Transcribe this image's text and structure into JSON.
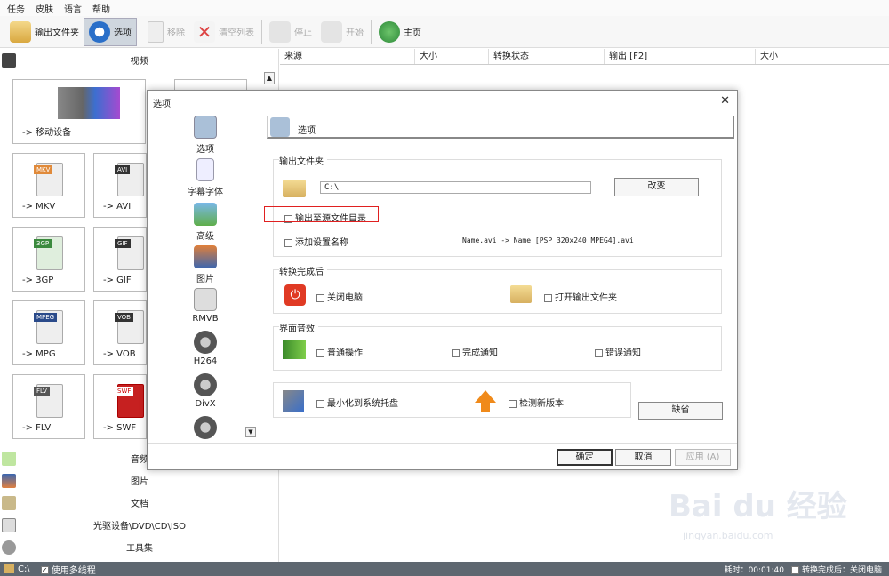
{
  "menu": [
    "任务",
    "皮肤",
    "语言",
    "帮助"
  ],
  "toolbar": {
    "output_folder": "输出文件夹",
    "options": "选项",
    "remove": "移除",
    "clear_list": "清空列表",
    "stop": "停止",
    "start": "开始",
    "home": "主页"
  },
  "left": {
    "video": "视频",
    "audio": "音频",
    "picture": "图片",
    "document": "文档",
    "rom": "光驱设备\\DVD\\CD\\ISO",
    "tools": "工具集",
    "tiles": {
      "mobile": "-> 移动设备",
      "mkv": "-> MKV",
      "avi": "-> AVI",
      "3gp": "-> 3GP",
      "gif": "-> GIF",
      "mpg": "-> MPG",
      "vob": "-> VOB",
      "flv": "-> FLV",
      "swf": "-> SWF"
    },
    "tags": {
      "avi": "AVI",
      "gif": "GIF",
      "mpeg": "MPEG",
      "vob": "VOB",
      "flv": "FLV",
      "swf": "SWF",
      "3gp": "3GP"
    }
  },
  "grid": {
    "cols": [
      "来源",
      "大小",
      "转换状态",
      "输出 [F2]",
      "大小"
    ]
  },
  "dialog": {
    "title": "选项",
    "header": "选项",
    "nav": [
      "选项",
      "字幕字体",
      "高级",
      "图片",
      "RMVB",
      "H264",
      "DivX"
    ],
    "output_folder": {
      "title": "输出文件夹",
      "path": "C:\\",
      "change": "改变",
      "to_source": "输出至源文件目录",
      "add_name": "添加设置名称",
      "example": "Name.avi  -> Name [PSP 320x240 MPEG4].avi"
    },
    "after": {
      "title": "转换完成后",
      "shutdown": "关闭电脑",
      "open_folder": "打开输出文件夹"
    },
    "sound": {
      "title": "界面音效",
      "normal": "普通操作",
      "done": "完成通知",
      "error": "错误通知"
    },
    "misc": {
      "minimize": "最小化到系统托盘",
      "check_update": "检测新版本"
    },
    "default": "缺省",
    "ok": "确定",
    "cancel": "取消",
    "apply": "应用 (A)"
  },
  "status": {
    "path": "C:\\",
    "multithread": "使用多线程",
    "elapsed": "耗时：00:01:40",
    "after_done": "转换完成后：关闭电脑"
  },
  "watermark": {
    "logo": "Bai du 经验",
    "url": "jingyan.baidu.com"
  }
}
